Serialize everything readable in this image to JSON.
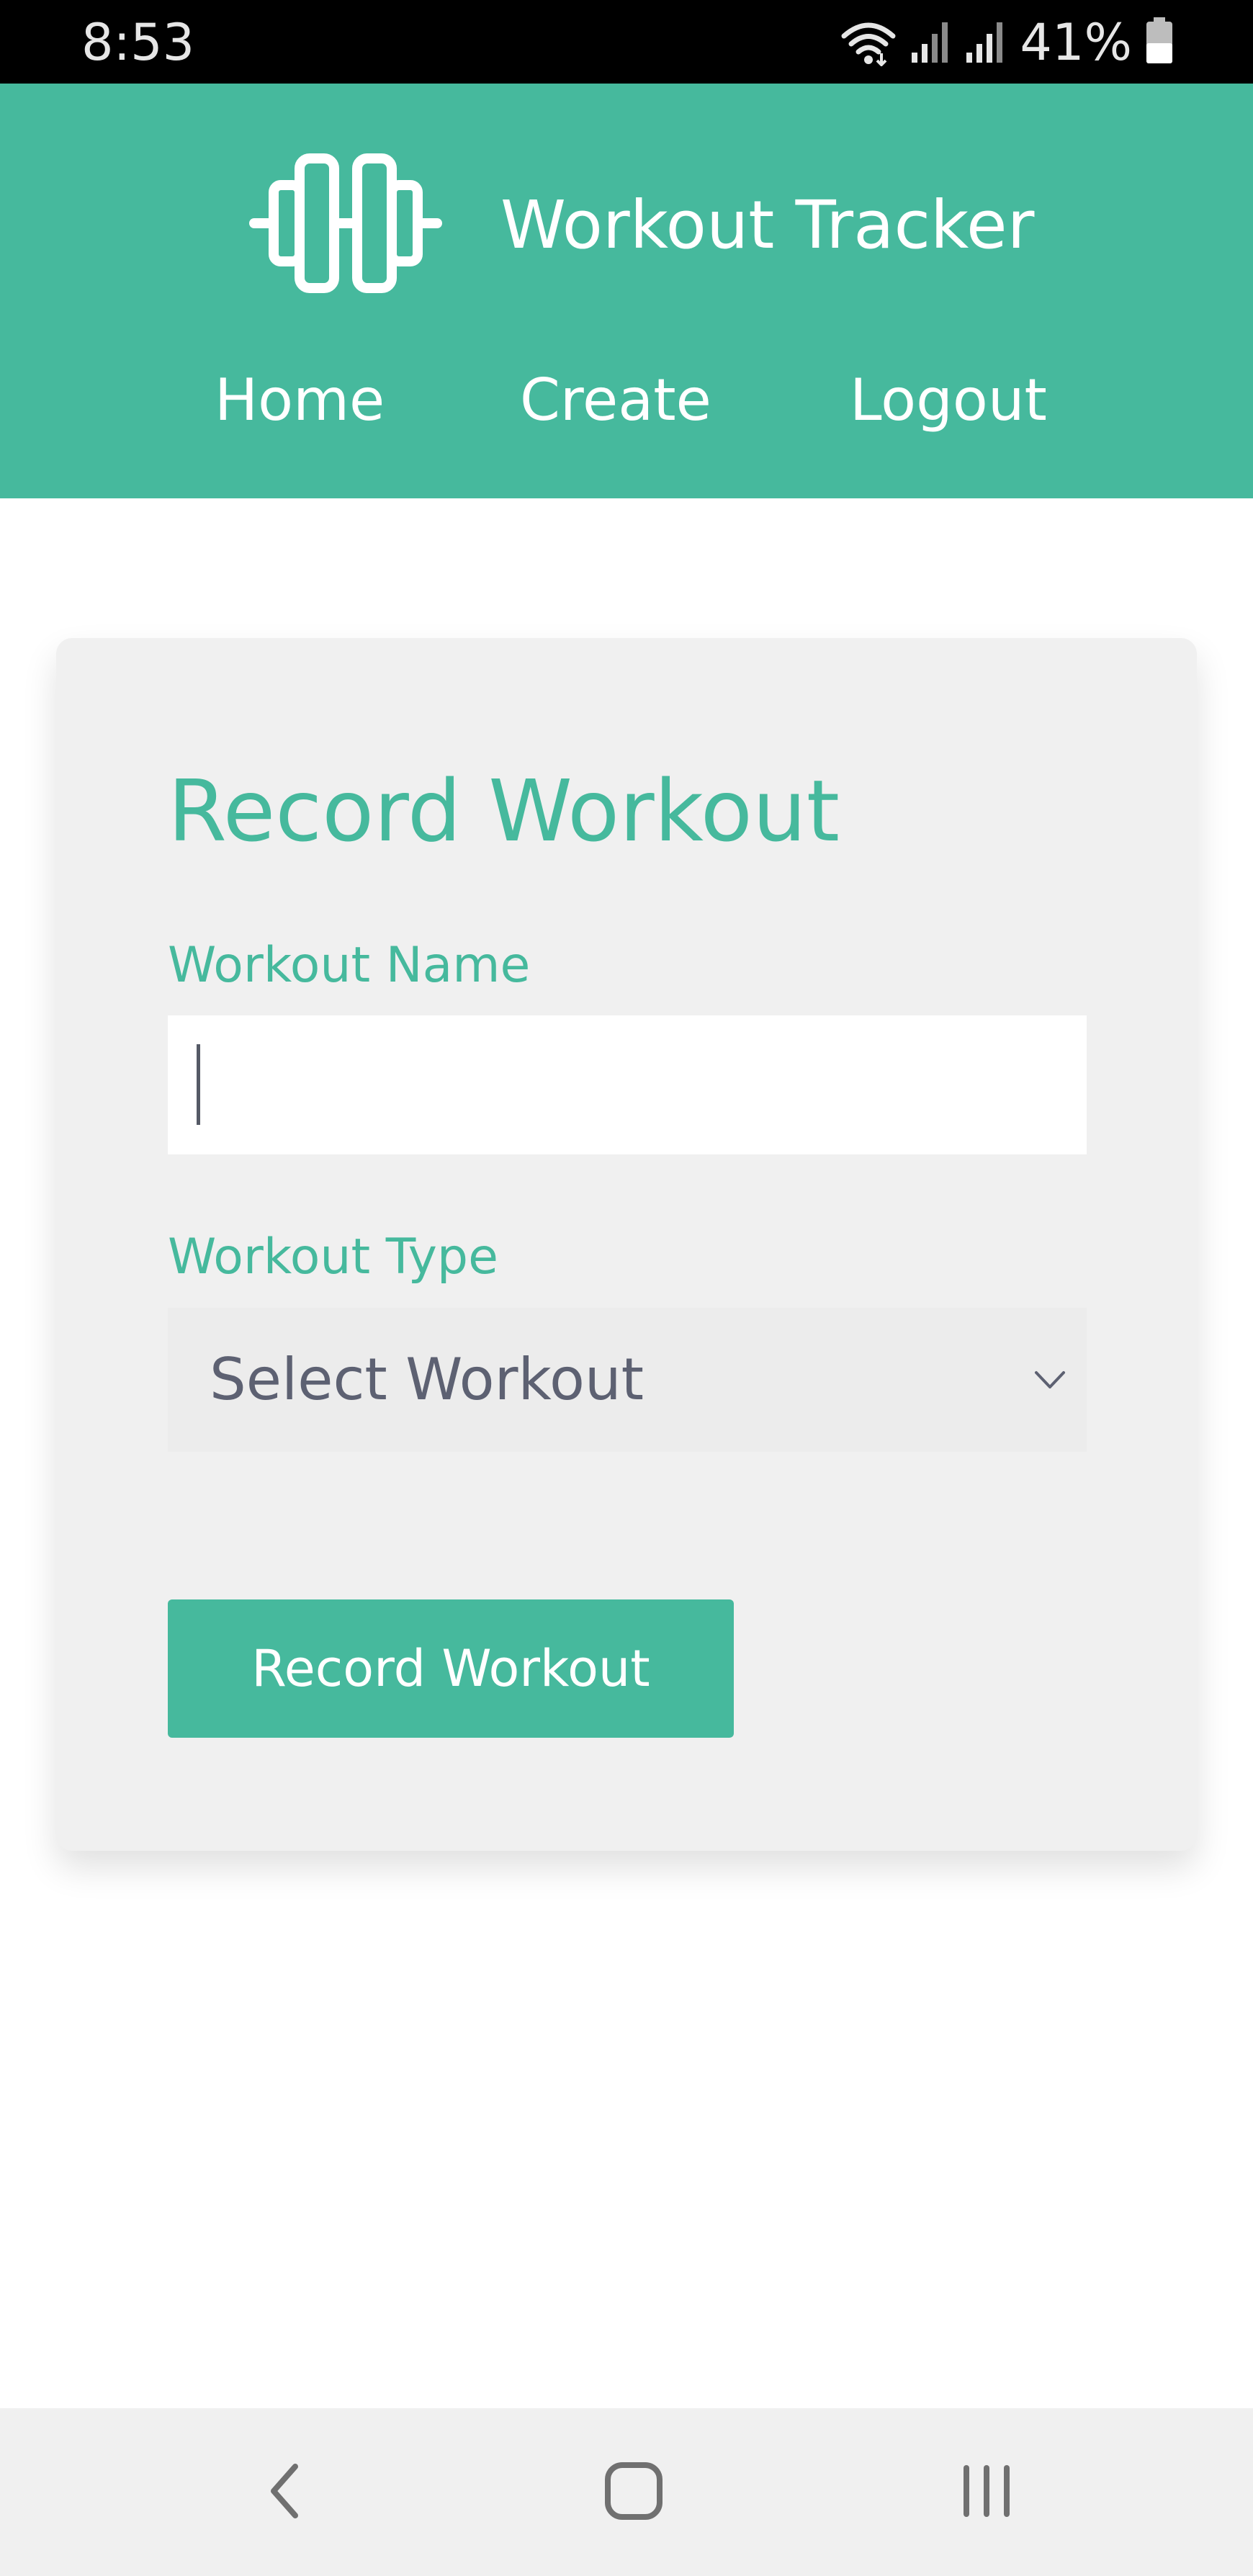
{
  "status_bar": {
    "time": "8:53",
    "battery_percent": "41%",
    "icons": [
      "wifi-icon",
      "signal-icon",
      "signal-icon",
      "battery-icon"
    ]
  },
  "header": {
    "brand_icon": "dumbbell-icon",
    "brand_title": "Workout Tracker",
    "nav": {
      "home": "Home",
      "create": "Create",
      "logout": "Logout"
    }
  },
  "form": {
    "title": "Record Workout",
    "workout_name_label": "Workout Name",
    "workout_name_value": "",
    "workout_type_label": "Workout Type",
    "workout_type_selected": "Select Workout",
    "submit_label": "Record Workout"
  },
  "system_nav": {
    "icons": [
      "back-icon",
      "home-icon",
      "recent-apps-icon"
    ]
  },
  "colors": {
    "accent": "#46b99d",
    "card_background": "#f0f0f0",
    "select_text": "#5d6172"
  }
}
